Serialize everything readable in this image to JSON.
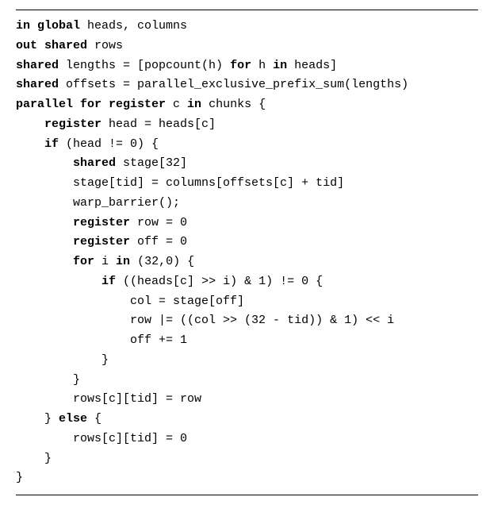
{
  "code": {
    "lines": [
      {
        "indent": 0,
        "segments": [
          {
            "t": "in global",
            "bold": true
          },
          {
            "t": " heads, columns"
          }
        ]
      },
      {
        "indent": 0,
        "segments": [
          {
            "t": "out shared",
            "bold": true
          },
          {
            "t": " rows"
          }
        ]
      },
      {
        "indent": 0,
        "segments": [
          {
            "t": "shared",
            "bold": true
          },
          {
            "t": " lengths = [popcount(h) "
          },
          {
            "t": "for",
            "bold": true
          },
          {
            "t": " h "
          },
          {
            "t": "in",
            "bold": true
          },
          {
            "t": " heads]"
          }
        ]
      },
      {
        "indent": 0,
        "segments": [
          {
            "t": "shared",
            "bold": true
          },
          {
            "t": " offsets = parallel_exclusive_prefix_sum(lengths)"
          }
        ]
      },
      {
        "indent": 0,
        "segments": [
          {
            "t": "parallel for register",
            "bold": true
          },
          {
            "t": " c "
          },
          {
            "t": "in",
            "bold": true
          },
          {
            "t": " chunks {"
          }
        ]
      },
      {
        "indent": 1,
        "segments": [
          {
            "t": "register",
            "bold": true
          },
          {
            "t": " head = heads[c]"
          }
        ]
      },
      {
        "indent": 1,
        "segments": [
          {
            "t": "if",
            "bold": true
          },
          {
            "t": " (head != 0) {"
          }
        ]
      },
      {
        "indent": 2,
        "segments": [
          {
            "t": "shared",
            "bold": true
          },
          {
            "t": " stage[32]"
          }
        ]
      },
      {
        "indent": 2,
        "segments": [
          {
            "t": "stage[tid] = columns[offsets[c] + tid]"
          }
        ]
      },
      {
        "indent": 2,
        "segments": [
          {
            "t": "warp_barrier();"
          }
        ]
      },
      {
        "indent": 2,
        "segments": [
          {
            "t": "register",
            "bold": true
          },
          {
            "t": " row = 0"
          }
        ]
      },
      {
        "indent": 2,
        "segments": [
          {
            "t": "register",
            "bold": true
          },
          {
            "t": " off = 0"
          }
        ]
      },
      {
        "indent": 2,
        "segments": [
          {
            "t": "for",
            "bold": true
          },
          {
            "t": " i "
          },
          {
            "t": "in",
            "bold": true
          },
          {
            "t": " (32,0) {"
          }
        ]
      },
      {
        "indent": 3,
        "segments": [
          {
            "t": "if",
            "bold": true
          },
          {
            "t": " ((heads[c] >> i) & 1) != 0 {"
          }
        ]
      },
      {
        "indent": 4,
        "segments": [
          {
            "t": "col = stage[off]"
          }
        ]
      },
      {
        "indent": 4,
        "segments": [
          {
            "t": "row |= ((col >> (32 - tid)) & 1) << i"
          }
        ]
      },
      {
        "indent": 4,
        "segments": [
          {
            "t": "off += 1"
          }
        ]
      },
      {
        "indent": 3,
        "segments": [
          {
            "t": "}"
          }
        ]
      },
      {
        "indent": 2,
        "segments": [
          {
            "t": "}"
          }
        ]
      },
      {
        "indent": 2,
        "segments": [
          {
            "t": "rows[c][tid] = row"
          }
        ]
      },
      {
        "indent": 1,
        "segments": [
          {
            "t": "} "
          },
          {
            "t": "else",
            "bold": true
          },
          {
            "t": " {"
          }
        ]
      },
      {
        "indent": 2,
        "segments": [
          {
            "t": "rows[c][tid] = 0"
          }
        ]
      },
      {
        "indent": 1,
        "segments": [
          {
            "t": "}"
          }
        ]
      },
      {
        "indent": 0,
        "segments": [
          {
            "t": "}"
          }
        ]
      }
    ],
    "indent_unit": "    "
  }
}
